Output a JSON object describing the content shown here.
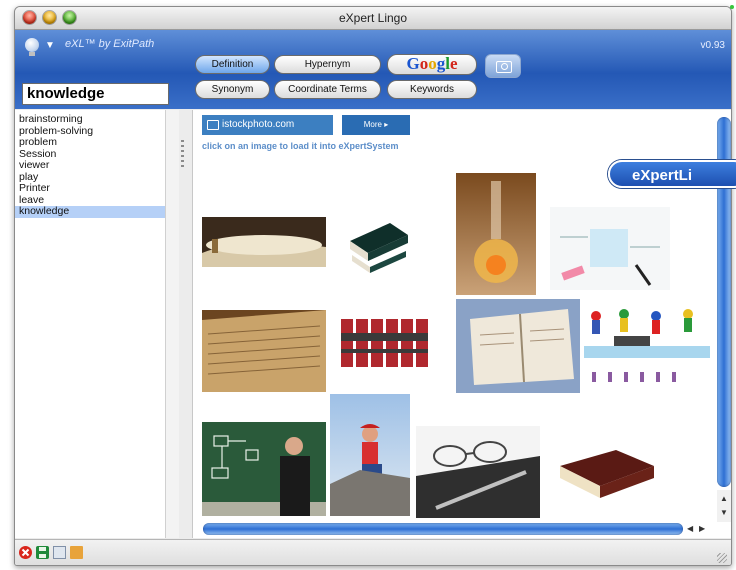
{
  "window": {
    "title": "eXpert Lingo"
  },
  "toolbar": {
    "brand": "eXL™ by ExitPath",
    "version": "v0.93",
    "search_value": "knowledge",
    "buttons": {
      "definition": "Definition",
      "hypernym": "Hypernym",
      "google": "Google",
      "synonym": "Synonym",
      "coordinate_terms": "Coordinate Terms",
      "keywords": "Keywords"
    }
  },
  "sidebar": {
    "items": [
      "brainstorming",
      "problem-solving",
      "problem",
      "Session",
      "viewer",
      "play",
      "Printer",
      "leave",
      "knowledge"
    ],
    "selected": "knowledge"
  },
  "content": {
    "istock_label": "istockphoto.com",
    "more_label": "More ▸",
    "instruction": "click on an image to load it into eXpertSystem"
  },
  "overlay": {
    "label": "eXpertLi"
  },
  "colors": {
    "toolbar_blue": "#2458b5",
    "selection": "#b5d0f7",
    "link_blue": "#5c8ec9"
  }
}
